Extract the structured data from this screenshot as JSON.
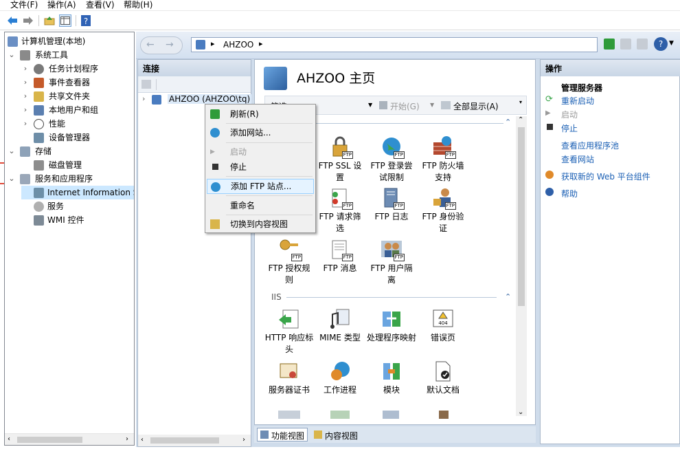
{
  "menubar": {
    "items": [
      "文件(F)",
      "操作(A)",
      "查看(V)",
      "帮助(H)"
    ]
  },
  "toolbar": {
    "icons": [
      "back-arrow-icon",
      "forward-arrow-icon",
      "up-folder-icon",
      "console-tree-icon",
      "help-icon"
    ]
  },
  "tree": {
    "root": "计算机管理(本地)",
    "system_tools": "系统工具",
    "task_scheduler": "任务计划程序",
    "event_viewer": "事件查看器",
    "shared_folders": "共享文件夹",
    "local_users": "本地用户和组",
    "performance": "性能",
    "device_manager": "设备管理器",
    "storage": "存储",
    "disk_mgmt": "磁盘管理",
    "services_apps": "服务和应用程序",
    "iis": "Internet Information S",
    "services": "服务",
    "wmi": "WMI 控件"
  },
  "address": {
    "path": "AHZOO"
  },
  "connections": {
    "title": "连接",
    "server": "AHZOO (AHZOO\\tq)"
  },
  "context_menu": {
    "refresh": "刷新(R)",
    "add_site": "添加网站...",
    "start": "启动",
    "stop": "停止",
    "add_ftp": "添加 FTP 站点...",
    "rename": "重命名",
    "switch_view": "切换到内容视图"
  },
  "center": {
    "title": "AHZOO 主页",
    "filter_label": "筛选:",
    "start_label": "开始(G)",
    "show_all_label": "全部显示(A)",
    "iis_group": "IIS",
    "ftp_features": [
      {
        "label": "FTP SSL 设置",
        "icon": "lock-icon"
      },
      {
        "label": "FTP 登录尝试限制",
        "icon": "globe-icon"
      },
      {
        "label": "FTP 防火墙支持",
        "icon": "firewall-icon"
      },
      {
        "label": "FTP 请求筛选",
        "icon": "request-filter-icon"
      },
      {
        "label": "FTP 日志",
        "icon": "log-icon"
      },
      {
        "label": "FTP 身份验证",
        "icon": "user-lock-icon"
      },
      {
        "label": "FTP 授权规则",
        "icon": "key-icon"
      },
      {
        "label": "FTP 消息",
        "icon": "message-icon"
      },
      {
        "label": "FTP 用户隔离",
        "icon": "users-icon"
      }
    ],
    "iis_features": [
      {
        "label": "HTTP 响应标头",
        "icon": "header-icon"
      },
      {
        "label": "MIME 类型",
        "icon": "mime-icon"
      },
      {
        "label": "处理程序映射",
        "icon": "handler-icon"
      },
      {
        "label": "错误页",
        "icon": "error-page-icon"
      },
      {
        "label": "服务器证书",
        "icon": "certificate-icon"
      },
      {
        "label": "工作进程",
        "icon": "worker-process-icon"
      },
      {
        "label": "模块",
        "icon": "module-icon"
      },
      {
        "label": "默认文档",
        "icon": "default-doc-icon"
      }
    ]
  },
  "view_tabs": {
    "features": "功能视图",
    "content": "内容视图"
  },
  "actions": {
    "title": "操作",
    "manage_server": "管理服务器",
    "restart": "重新启动",
    "start": "启动",
    "stop": "停止",
    "view_pools": "查看应用程序池",
    "view_sites": "查看网站",
    "get_components": "获取新的 Web 平台组件",
    "help": "帮助"
  }
}
